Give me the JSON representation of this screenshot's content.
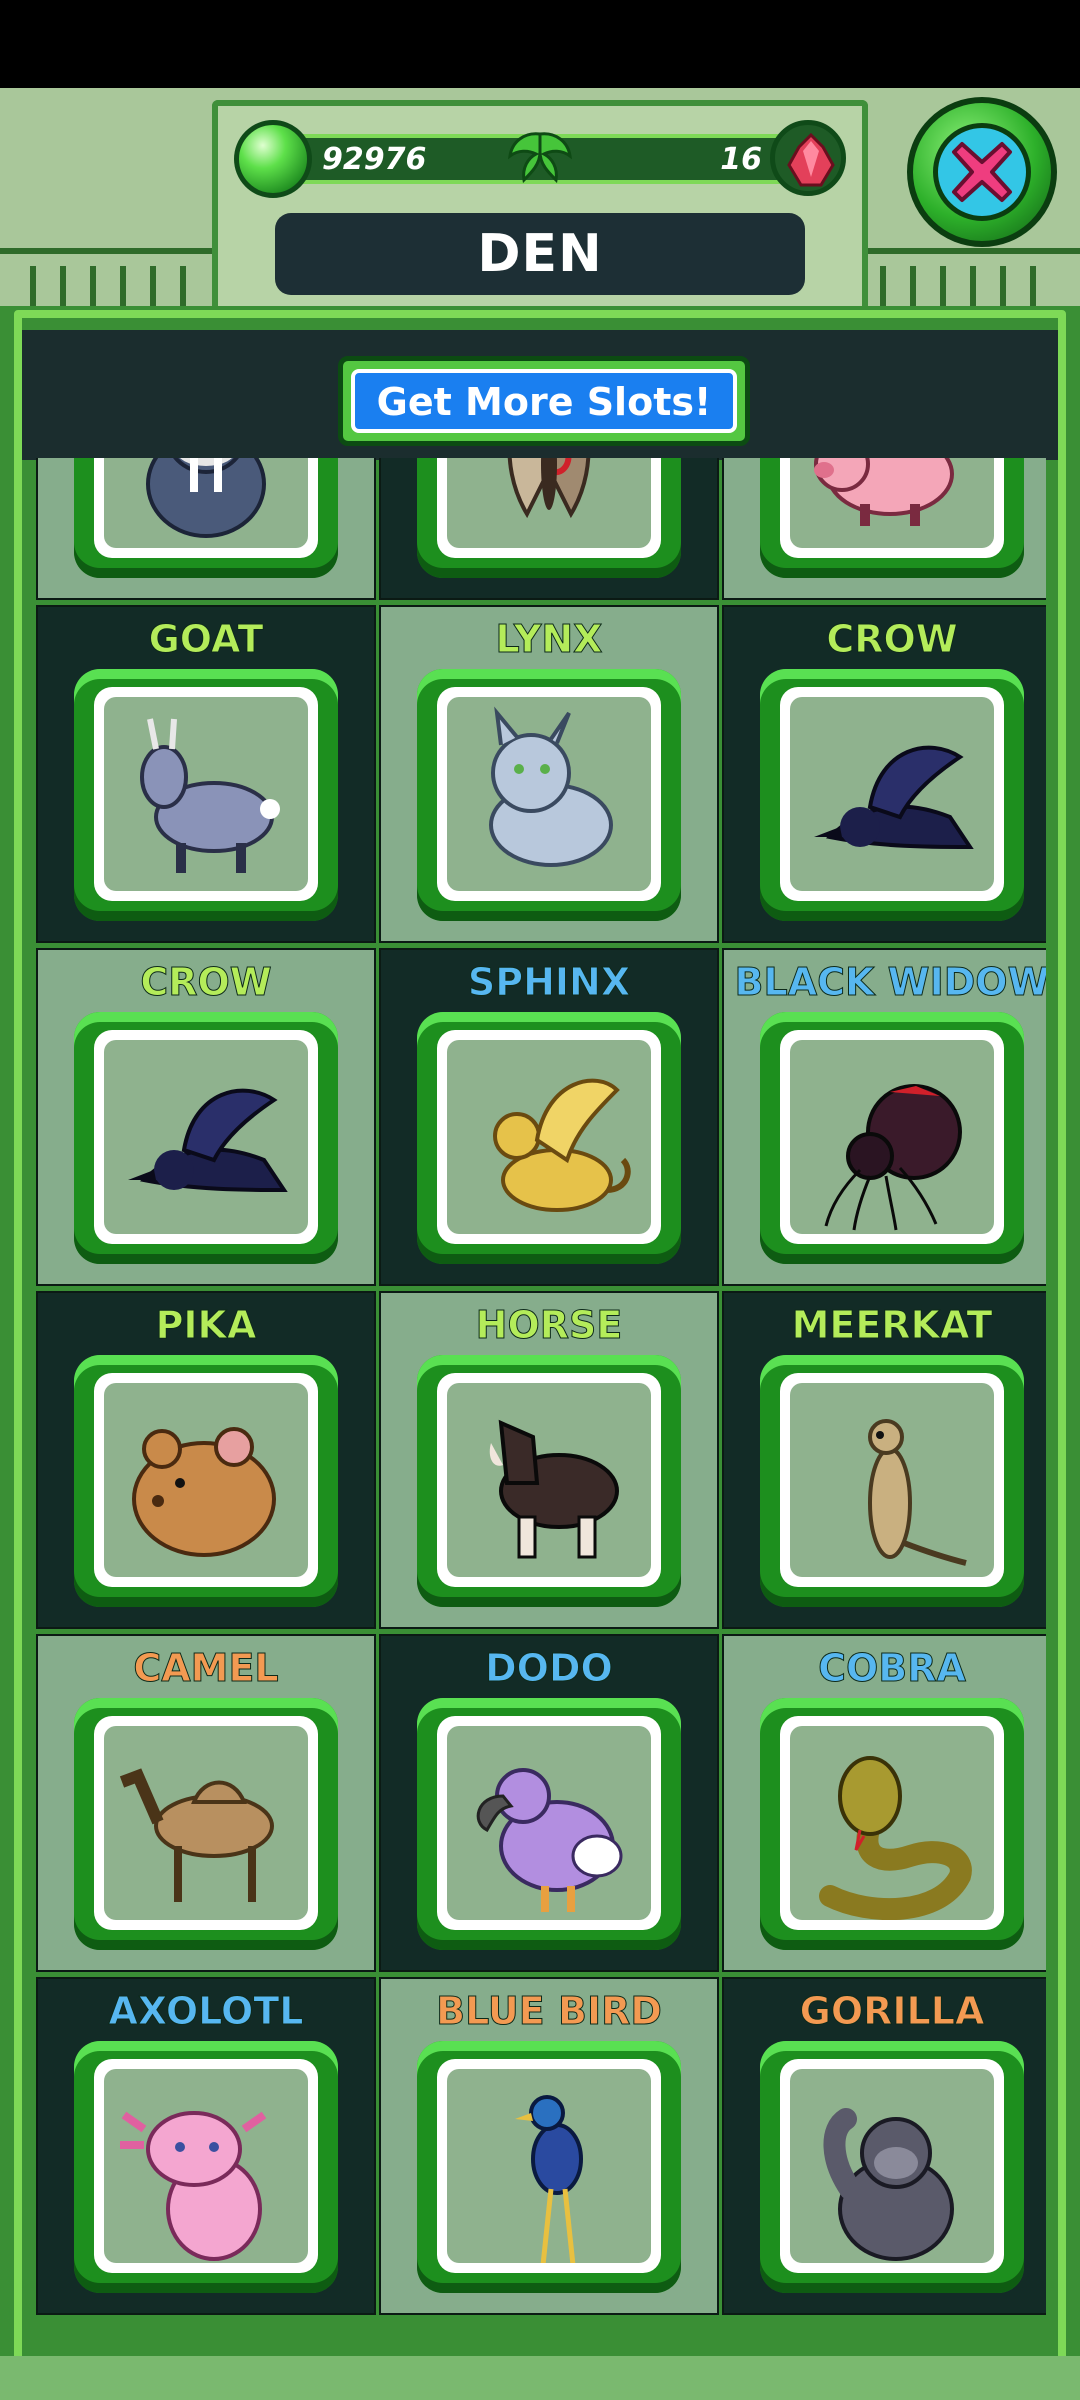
{
  "header": {
    "coins": "92976",
    "gems": "16",
    "title": "DEN"
  },
  "buttons": {
    "get_more_slots": "Get More Slots!"
  },
  "colors": {
    "name_green": "#b4ec5a",
    "name_blue": "#57b7f0",
    "name_orange": "#f39a52"
  },
  "animals": [
    {
      "name": "",
      "icon": "walrus-icon",
      "color": "#b4ec5a"
    },
    {
      "name": "",
      "icon": "moth-icon",
      "color": "#b4ec5a"
    },
    {
      "name": "",
      "icon": "flying-pig-icon",
      "color": "#b4ec5a"
    },
    {
      "name": "GOAT",
      "icon": "goat-icon",
      "color": "#b4ec5a"
    },
    {
      "name": "LYNX",
      "icon": "lynx-icon",
      "color": "#b4ec5a"
    },
    {
      "name": "CROW",
      "icon": "crow-icon",
      "color": "#b4ec5a"
    },
    {
      "name": "CROW",
      "icon": "crow-icon",
      "color": "#b4ec5a"
    },
    {
      "name": "SPHINX",
      "icon": "sphinx-icon",
      "color": "#57b7f0"
    },
    {
      "name": "BLACK WIDOW",
      "icon": "spider-icon",
      "color": "#57b7f0"
    },
    {
      "name": "PIKA",
      "icon": "pika-icon",
      "color": "#b4ec5a"
    },
    {
      "name": "HORSE",
      "icon": "horse-icon",
      "color": "#b4ec5a"
    },
    {
      "name": "MEERKAT",
      "icon": "meerkat-icon",
      "color": "#b4ec5a"
    },
    {
      "name": "CAMEL",
      "icon": "camel-icon",
      "color": "#f39a52"
    },
    {
      "name": "DODO",
      "icon": "dodo-icon",
      "color": "#57b7f0"
    },
    {
      "name": "COBRA",
      "icon": "cobra-icon",
      "color": "#57b7f0"
    },
    {
      "name": "AXOLOTL",
      "icon": "axolotl-icon",
      "color": "#57b7f0"
    },
    {
      "name": "BLUE BIRD",
      "icon": "blue-bird-icon",
      "color": "#f39a52"
    },
    {
      "name": "GORILLA",
      "icon": "gorilla-icon",
      "color": "#f39a52"
    }
  ]
}
